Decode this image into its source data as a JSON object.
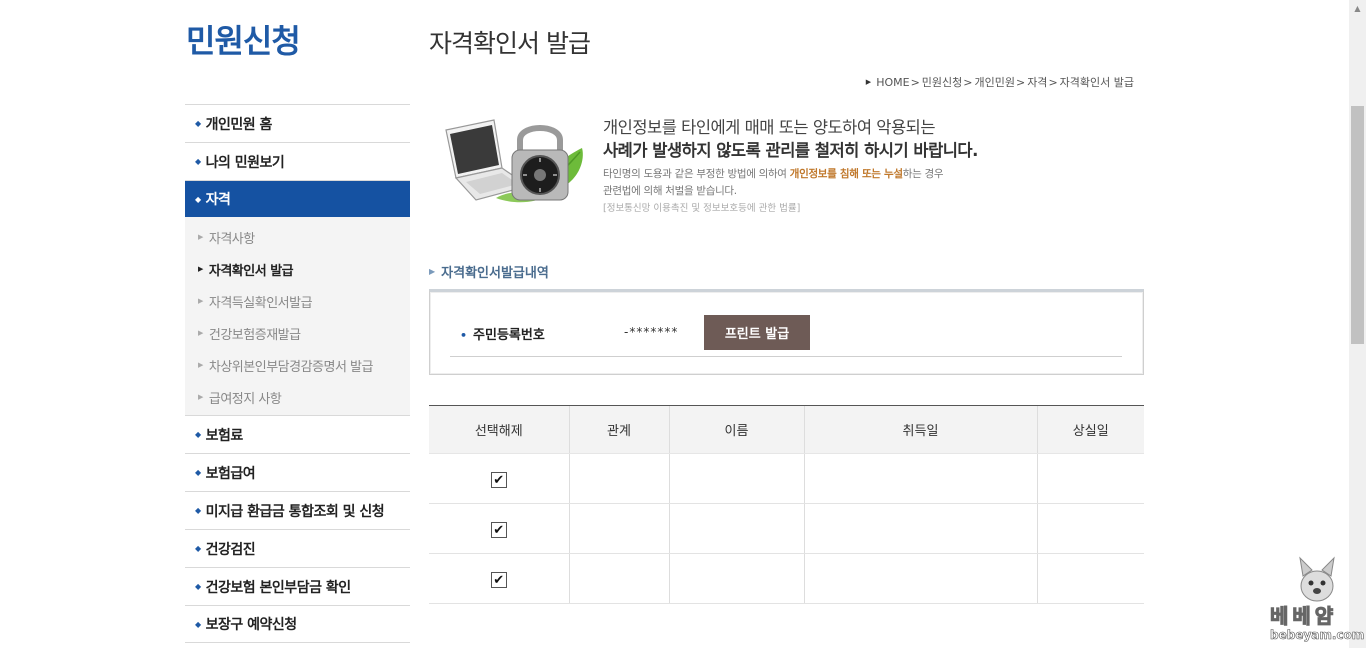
{
  "sidebar": {
    "title": "민원신청",
    "items_top": [
      {
        "label": "개인민원 홈"
      },
      {
        "label": "나의 민원보기"
      }
    ],
    "active": {
      "label": "자격"
    },
    "subitems": [
      {
        "label": "자격사항"
      },
      {
        "label": "자격확인서 발급"
      },
      {
        "label": "자격득실확인서발급"
      },
      {
        "label": "건강보험증재발급"
      },
      {
        "label": "차상위본인부담경감증명서 발급"
      },
      {
        "label": "급여정지 사항"
      }
    ],
    "items_bottom": [
      {
        "label": "보험료"
      },
      {
        "label": "보험급여"
      },
      {
        "label": "미지급 환급금 통합조회 및 신청"
      },
      {
        "label": "건강검진"
      },
      {
        "label": "건강보험 본인부담금 확인"
      },
      {
        "label": "보장구 예약신청"
      }
    ]
  },
  "main": {
    "title": "자격확인서 발급",
    "breadcrumb": [
      "HOME",
      "민원신청",
      "개인민원",
      "자격",
      "자격확인서 발급"
    ]
  },
  "notice": {
    "line1": "개인정보를 타인에게 매매 또는 양도하여 악용되는",
    "line2": "사례가 발생하지 않도록 관리를 철저히 하시기 바랍니다.",
    "body1_pre": "타인명의 도용과 같은 부정한 방법에 의하여 ",
    "body1_hl": "개인정보를 침해 또는 누설",
    "body1_post": "하는 경우",
    "body2": "관련법에 의해 처벌을 받습니다.",
    "law": "[정보통신망 이용촉진 및 정보보호등에 관한 법률]"
  },
  "section": {
    "title": "자격확인서발급내역",
    "id_label": "주민등록번호",
    "id_value": "-*******",
    "print_button": "프린트 발급"
  },
  "table": {
    "headers": [
      "선택해제",
      "관계",
      "이름",
      "취득일",
      "상실일"
    ],
    "rows": [
      {
        "checked": true,
        "relation": "",
        "name": "",
        "acquired": "",
        "lost": ""
      },
      {
        "checked": true,
        "relation": "",
        "name": "",
        "acquired": "",
        "lost": ""
      },
      {
        "checked": true,
        "relation": "",
        "name": "",
        "acquired": "",
        "lost": ""
      }
    ]
  },
  "watermark": {
    "text1": "베베얌",
    "text2": "bebeyam.com"
  }
}
